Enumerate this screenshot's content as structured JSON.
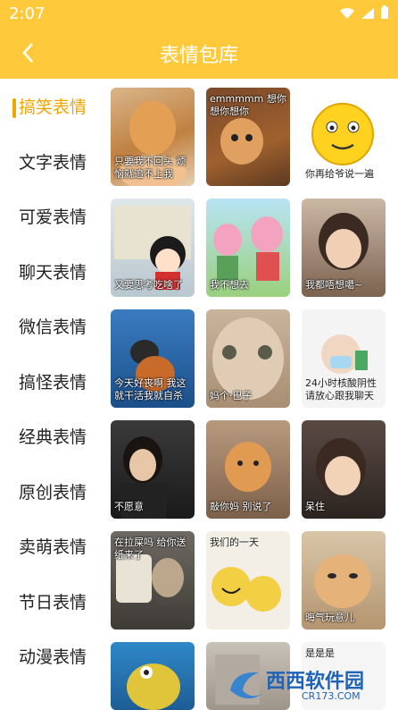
{
  "status": {
    "time": "2:07",
    "icons": [
      "wifi-icon",
      "signal-icon",
      "battery-icon"
    ]
  },
  "appbar": {
    "title": "表情包库",
    "back_icon": "chevron-left-icon"
  },
  "colors": {
    "accent": "#FFC93C",
    "active_text": "#F2A500"
  },
  "sidebar": {
    "items": [
      {
        "label": "搞笑表情",
        "active": true
      },
      {
        "label": "文字表情"
      },
      {
        "label": "可爱表情"
      },
      {
        "label": "聊天表情"
      },
      {
        "label": "微信表情"
      },
      {
        "label": "搞怪表情"
      },
      {
        "label": "经典表情"
      },
      {
        "label": "原创表情"
      },
      {
        "label": "卖萌表情"
      },
      {
        "label": "节日表情"
      },
      {
        "label": "动漫表情"
      }
    ]
  },
  "stickers": [
    {
      "caption": "只要我不回头 烦恼就追不上我"
    },
    {
      "caption": "emmmmm 想你想你想你"
    },
    {
      "caption": "你再给爷说一遍"
    },
    {
      "caption": "又要思考吃啥了"
    },
    {
      "caption": "我不想去"
    },
    {
      "caption": "我都唔想噶~"
    },
    {
      "caption": "今天好丧啊 我这就干活我就自杀"
    },
    {
      "caption": "妈个·巴子"
    },
    {
      "caption": "24小时核酸阴性 请放心跟我聊天"
    },
    {
      "caption": "不愿意"
    },
    {
      "caption": "敲你妈 别说了"
    },
    {
      "caption": "呆住"
    },
    {
      "caption": "在拉屎吗 给你送纸来了"
    },
    {
      "caption": "我们的一天"
    },
    {
      "caption": "晦气玩意儿"
    },
    {
      "caption": ""
    },
    {
      "caption": ""
    },
    {
      "caption": "是是是"
    }
  ],
  "watermark": {
    "brand": "西西软件园",
    "url": "CR173.COM"
  }
}
